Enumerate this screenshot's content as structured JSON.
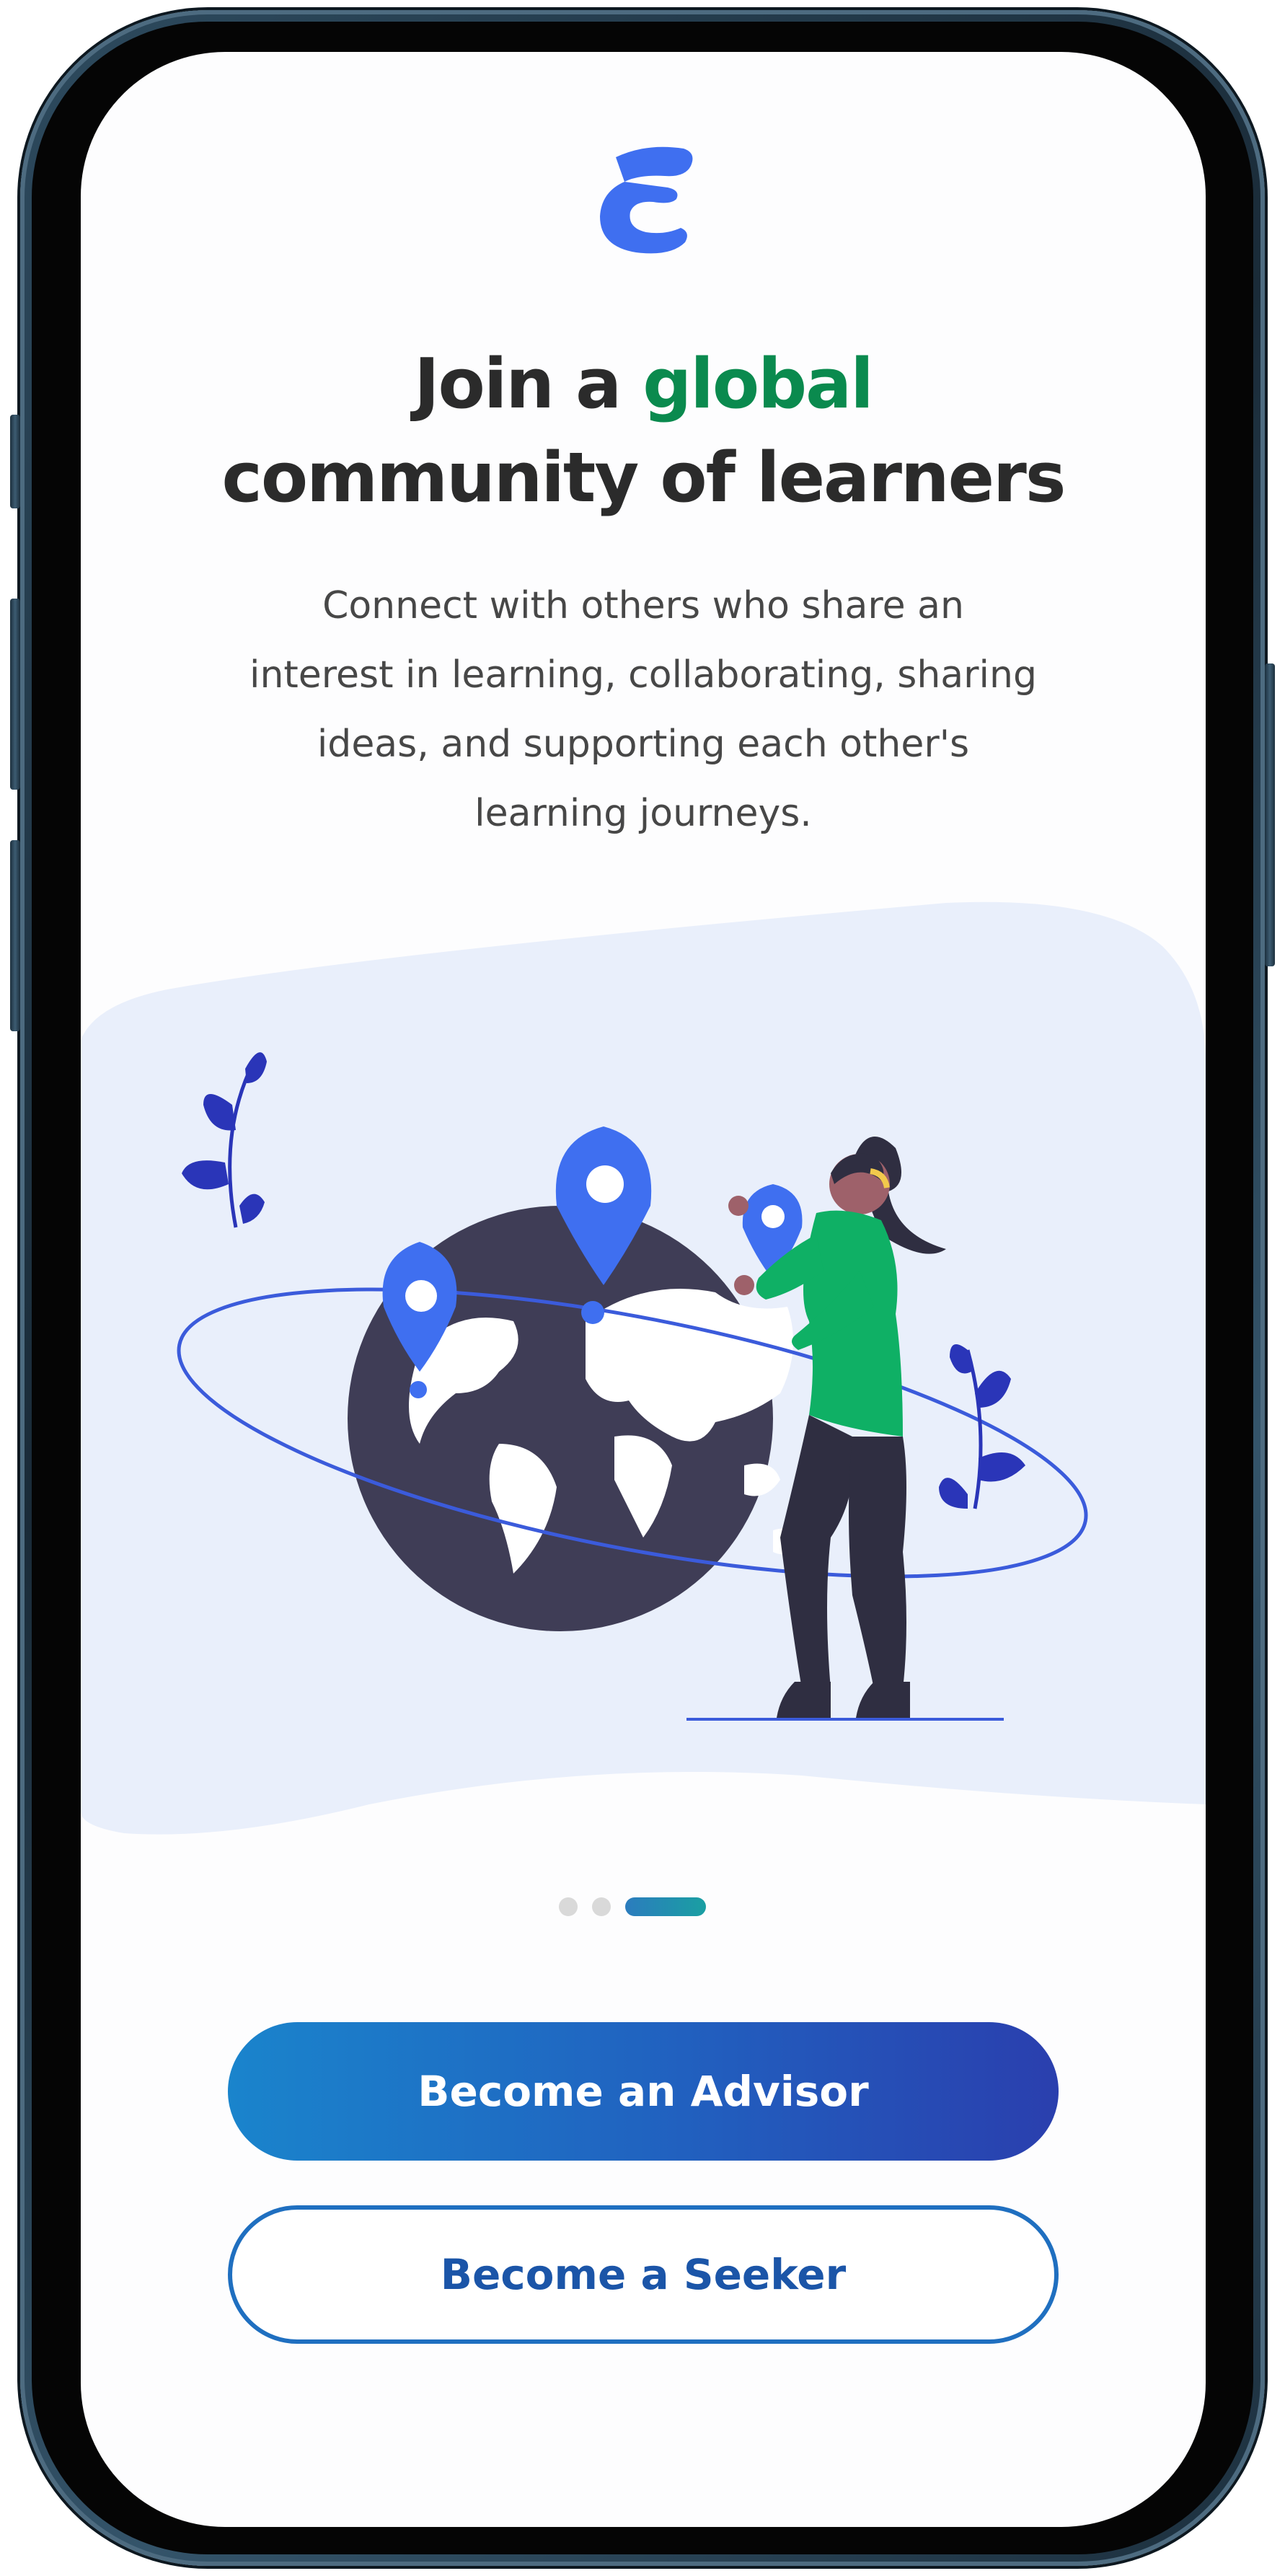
{
  "onboarding": {
    "headline_prefix": "Join a ",
    "headline_accent": "global",
    "headline_line2": "community of learners",
    "subtitle": "Connect with others who share an interest in learning, collaborating, sharing ideas, and supporting each other's learning journeys.",
    "pager": {
      "total": 3,
      "active": 3
    },
    "primary_button": "Become an Advisor",
    "secondary_button": "Become a Seeker",
    "logo_icon": "brand-logo-icon",
    "illustration": "woman-pinning-locations-on-globe"
  },
  "colors": {
    "accent_green": "#0a8a4e",
    "brand_blue": "#3f6ff0",
    "button_gradient_start": "#1a84cc",
    "button_gradient_end": "#2a3fae",
    "background_wave": "#e9effb"
  }
}
